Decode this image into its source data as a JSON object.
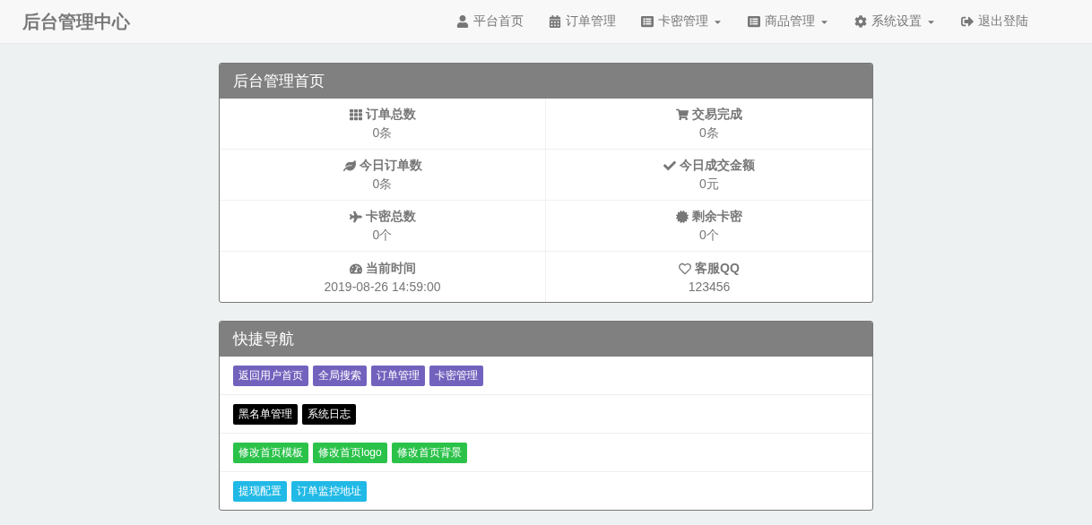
{
  "brand": "后台管理中心",
  "nav": [
    {
      "kind": "user",
      "label": "平台首页",
      "dropdown": false
    },
    {
      "kind": "calendar",
      "label": "订单管理",
      "dropdown": false
    },
    {
      "kind": "list",
      "label": "卡密管理",
      "dropdown": true
    },
    {
      "kind": "list",
      "label": "商品管理",
      "dropdown": true
    },
    {
      "kind": "gear",
      "label": "系统设置",
      "dropdown": true
    },
    {
      "kind": "logout",
      "label": "退出登陆",
      "dropdown": false
    }
  ],
  "stats_panel": {
    "title": "后台管理首页",
    "items": [
      {
        "kind": "grid",
        "label": "订单总数",
        "value": "0条"
      },
      {
        "kind": "cart",
        "label": "交易完成",
        "value": "0条"
      },
      {
        "kind": "leaf",
        "label": "今日订单数",
        "value": "0条"
      },
      {
        "kind": "check",
        "label": "今日成交金额",
        "value": "0元"
      },
      {
        "kind": "plane",
        "label": "卡密总数",
        "value": "0个"
      },
      {
        "kind": "burst",
        "label": "剩余卡密",
        "value": "0个"
      },
      {
        "kind": "gauge",
        "label": "当前时间",
        "value": "2019-08-26 14:59:00"
      },
      {
        "kind": "heart",
        "label": "客服QQ",
        "value": "123456"
      }
    ]
  },
  "quick_nav": {
    "title": "快捷导航",
    "rows": [
      [
        {
          "label": "返回用户首页",
          "color": "#7362bd"
        },
        {
          "label": "全局搜索",
          "color": "#7362bd"
        },
        {
          "label": "订单管理",
          "color": "#7362bd"
        },
        {
          "label": "卡密管理",
          "color": "#7362bd"
        }
      ],
      [
        {
          "label": "黑名单管理",
          "color": "#000000"
        },
        {
          "label": "系统日志",
          "color": "#000000"
        }
      ],
      [
        {
          "label": "修改首页模板",
          "color": "#2bc24a"
        },
        {
          "label": "修改首页logo",
          "color": "#2bc24a"
        },
        {
          "label": "修改首页背景",
          "color": "#2bc24a"
        }
      ],
      [
        {
          "label": "提现配置",
          "color": "#21b9e6"
        },
        {
          "label": "订单监控地址",
          "color": "#21b9e6"
        }
      ]
    ]
  }
}
